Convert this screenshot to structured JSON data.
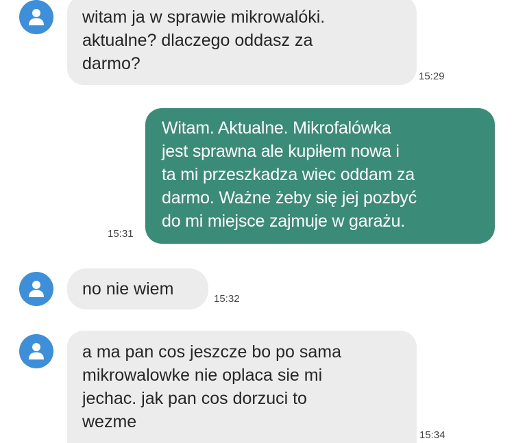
{
  "messages": [
    {
      "direction": "incoming",
      "text": "witam ja w sprawie mikrowalóki.\naktualne? dlaczego oddasz za\ndarmo?",
      "time": "15:29",
      "icon": "person-icon"
    },
    {
      "direction": "outgoing",
      "text": "Witam. Aktualne. Mikrofalówka\njest sprawna ale kupiłem nowa i\nta mi przeszkadza wiec oddam za\ndarmo. Ważne żeby się jej pozbyć\ndo mi miejsce zajmuje w garażu.",
      "time": "15:31"
    },
    {
      "direction": "incoming",
      "text": "no nie wiem",
      "time": "15:32",
      "icon": "person-icon"
    },
    {
      "direction": "incoming",
      "text": "a ma pan cos jeszcze bo po sama\nmikrowalowke nie oplaca sie mi\njechac. jak pan cos dorzuci to\nwezme",
      "time": "15:34",
      "icon": "person-icon"
    }
  ],
  "colors": {
    "avatar": "#3d8fd9",
    "incoming_bubble": "#ececec",
    "outgoing_bubble": "#3a8c79"
  }
}
